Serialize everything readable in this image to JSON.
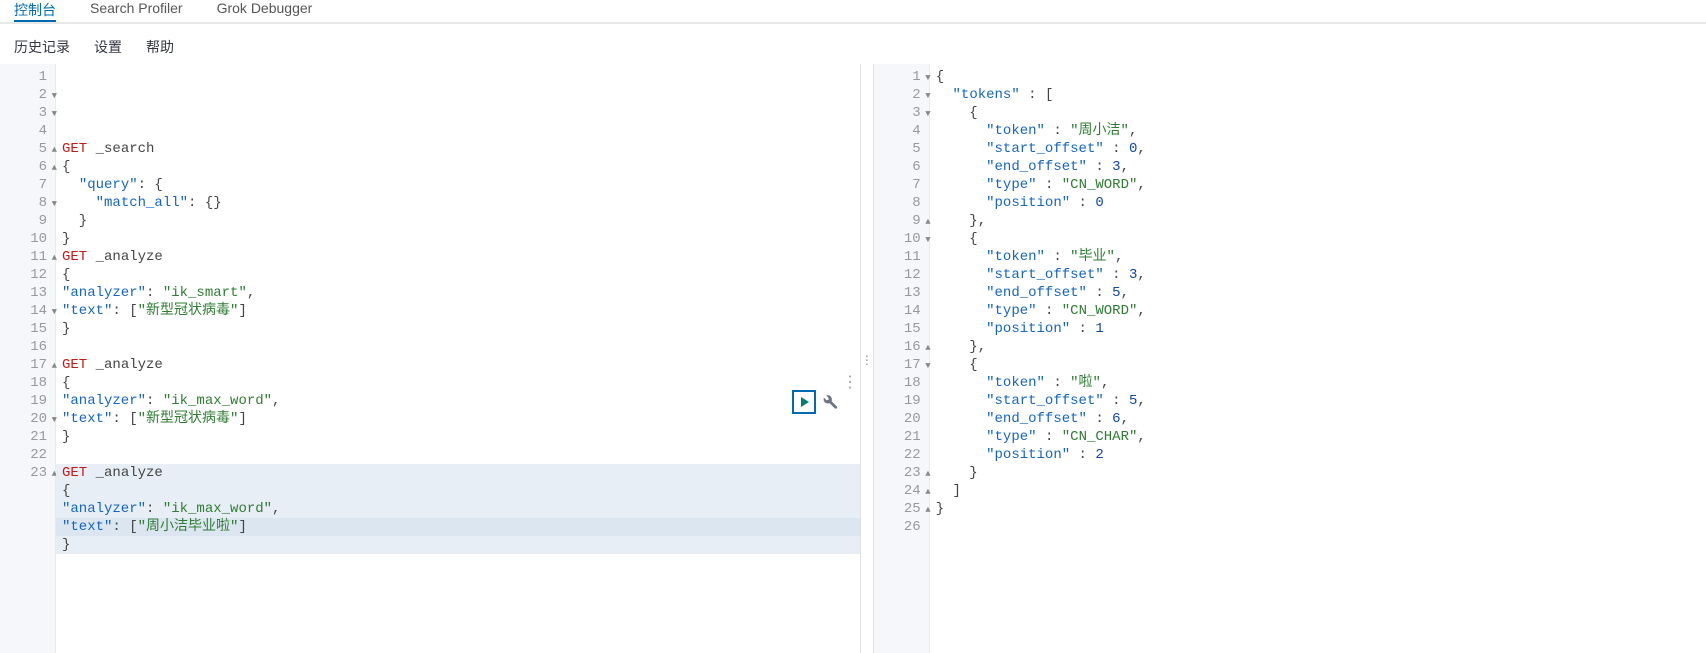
{
  "top_tabs": {
    "t1": "控制台",
    "t2": "Search Profiler",
    "t3": "Grok Debugger"
  },
  "submenu": {
    "history": "历史记录",
    "settings": "设置",
    "help": "帮助"
  },
  "editor": {
    "lines": [
      {
        "n": "1",
        "fold": "",
        "cls": "",
        "tokens": [
          [
            "method",
            "GET"
          ],
          [
            "punct",
            " "
          ],
          [
            "punct",
            "_search"
          ]
        ]
      },
      {
        "n": "2",
        "fold": "▼",
        "cls": "",
        "tokens": [
          [
            "punct",
            "{"
          ]
        ]
      },
      {
        "n": "3",
        "fold": "▼",
        "cls": "",
        "tokens": [
          [
            "punct",
            "  "
          ],
          [
            "key",
            "\"query\""
          ],
          [
            "punct",
            ": {"
          ]
        ]
      },
      {
        "n": "4",
        "fold": "",
        "cls": "",
        "tokens": [
          [
            "punct",
            "    "
          ],
          [
            "key",
            "\"match_all\""
          ],
          [
            "punct",
            ": {}"
          ]
        ]
      },
      {
        "n": "5",
        "fold": "▲",
        "cls": "",
        "tokens": [
          [
            "punct",
            "  }"
          ]
        ]
      },
      {
        "n": "6",
        "fold": "▲",
        "cls": "",
        "tokens": [
          [
            "punct",
            "}"
          ]
        ]
      },
      {
        "n": "7",
        "fold": "",
        "cls": "",
        "tokens": [
          [
            "method",
            "GET"
          ],
          [
            "punct",
            " "
          ],
          [
            "punct",
            "_analyze"
          ]
        ]
      },
      {
        "n": "8",
        "fold": "▼",
        "cls": "",
        "tokens": [
          [
            "punct",
            "{"
          ]
        ]
      },
      {
        "n": "9",
        "fold": "",
        "cls": "",
        "tokens": [
          [
            "key",
            "\"analyzer\""
          ],
          [
            "punct",
            ": "
          ],
          [
            "str",
            "\"ik_smart\""
          ],
          [
            "punct",
            ","
          ]
        ]
      },
      {
        "n": "10",
        "fold": "",
        "cls": "",
        "tokens": [
          [
            "key",
            "\"text\""
          ],
          [
            "punct",
            ": ["
          ],
          [
            "str",
            "\"新型冠状病毒\""
          ],
          [
            "punct",
            "]"
          ]
        ]
      },
      {
        "n": "11",
        "fold": "▲",
        "cls": "",
        "tokens": [
          [
            "punct",
            "}"
          ]
        ]
      },
      {
        "n": "12",
        "fold": "",
        "cls": "",
        "tokens": []
      },
      {
        "n": "13",
        "fold": "",
        "cls": "",
        "tokens": [
          [
            "method",
            "GET"
          ],
          [
            "punct",
            " "
          ],
          [
            "punct",
            "_analyze"
          ]
        ]
      },
      {
        "n": "14",
        "fold": "▼",
        "cls": "",
        "tokens": [
          [
            "punct",
            "{"
          ]
        ]
      },
      {
        "n": "15",
        "fold": "",
        "cls": "",
        "tokens": [
          [
            "key",
            "\"analyzer\""
          ],
          [
            "punct",
            ": "
          ],
          [
            "str",
            "\"ik_max_word\""
          ],
          [
            "punct",
            ","
          ]
        ]
      },
      {
        "n": "16",
        "fold": "",
        "cls": "",
        "tokens": [
          [
            "key",
            "\"text\""
          ],
          [
            "punct",
            ": ["
          ],
          [
            "str",
            "\"新型冠状病毒\""
          ],
          [
            "punct",
            "]"
          ]
        ]
      },
      {
        "n": "17",
        "fold": "▲",
        "cls": "",
        "tokens": [
          [
            "punct",
            "}"
          ]
        ]
      },
      {
        "n": "18",
        "fold": "",
        "cls": "",
        "tokens": []
      },
      {
        "n": "19",
        "fold": "",
        "cls": "hl-light",
        "tokens": [
          [
            "method",
            "GET"
          ],
          [
            "punct",
            " "
          ],
          [
            "punct",
            "_analyze"
          ]
        ]
      },
      {
        "n": "20",
        "fold": "▼",
        "cls": "hl-light",
        "tokens": [
          [
            "punct",
            "{"
          ]
        ]
      },
      {
        "n": "21",
        "fold": "",
        "cls": "hl-light",
        "tokens": [
          [
            "key",
            "\"analyzer\""
          ],
          [
            "punct",
            ": "
          ],
          [
            "str",
            "\"ik_max_word\""
          ],
          [
            "punct",
            ","
          ]
        ]
      },
      {
        "n": "22",
        "fold": "",
        "cls": "hl",
        "tokens": [
          [
            "key",
            "\"text\""
          ],
          [
            "punct",
            ": ["
          ],
          [
            "str",
            "\"周小洁毕业啦\""
          ],
          [
            "punct",
            "]"
          ]
        ]
      },
      {
        "n": "23",
        "fold": "▲",
        "cls": "hl-light",
        "tokens": [
          [
            "punct",
            "}"
          ]
        ]
      }
    ]
  },
  "output": {
    "lines": [
      {
        "n": "1",
        "fold": "▼",
        "tokens": [
          [
            "punct",
            "{"
          ]
        ]
      },
      {
        "n": "2",
        "fold": "▼",
        "tokens": [
          [
            "punct",
            "  "
          ],
          [
            "key",
            "\"tokens\""
          ],
          [
            "punct",
            " : ["
          ]
        ]
      },
      {
        "n": "3",
        "fold": "▼",
        "tokens": [
          [
            "punct",
            "    {"
          ]
        ]
      },
      {
        "n": "4",
        "fold": "",
        "tokens": [
          [
            "punct",
            "      "
          ],
          [
            "key",
            "\"token\""
          ],
          [
            "punct",
            " : "
          ],
          [
            "str",
            "\"周小洁\""
          ],
          [
            "punct",
            ","
          ]
        ]
      },
      {
        "n": "5",
        "fold": "",
        "tokens": [
          [
            "punct",
            "      "
          ],
          [
            "key",
            "\"start_offset\""
          ],
          [
            "punct",
            " : "
          ],
          [
            "num",
            "0"
          ],
          [
            "punct",
            ","
          ]
        ]
      },
      {
        "n": "6",
        "fold": "",
        "tokens": [
          [
            "punct",
            "      "
          ],
          [
            "key",
            "\"end_offset\""
          ],
          [
            "punct",
            " : "
          ],
          [
            "num",
            "3"
          ],
          [
            "punct",
            ","
          ]
        ]
      },
      {
        "n": "7",
        "fold": "",
        "tokens": [
          [
            "punct",
            "      "
          ],
          [
            "key",
            "\"type\""
          ],
          [
            "punct",
            " : "
          ],
          [
            "str",
            "\"CN_WORD\""
          ],
          [
            "punct",
            ","
          ]
        ]
      },
      {
        "n": "8",
        "fold": "",
        "tokens": [
          [
            "punct",
            "      "
          ],
          [
            "key",
            "\"position\""
          ],
          [
            "punct",
            " : "
          ],
          [
            "num",
            "0"
          ]
        ]
      },
      {
        "n": "9",
        "fold": "▲",
        "tokens": [
          [
            "punct",
            "    },"
          ]
        ]
      },
      {
        "n": "10",
        "fold": "▼",
        "tokens": [
          [
            "punct",
            "    {"
          ]
        ]
      },
      {
        "n": "11",
        "fold": "",
        "tokens": [
          [
            "punct",
            "      "
          ],
          [
            "key",
            "\"token\""
          ],
          [
            "punct",
            " : "
          ],
          [
            "str",
            "\"毕业\""
          ],
          [
            "punct",
            ","
          ]
        ]
      },
      {
        "n": "12",
        "fold": "",
        "tokens": [
          [
            "punct",
            "      "
          ],
          [
            "key",
            "\"start_offset\""
          ],
          [
            "punct",
            " : "
          ],
          [
            "num",
            "3"
          ],
          [
            "punct",
            ","
          ]
        ]
      },
      {
        "n": "13",
        "fold": "",
        "tokens": [
          [
            "punct",
            "      "
          ],
          [
            "key",
            "\"end_offset\""
          ],
          [
            "punct",
            " : "
          ],
          [
            "num",
            "5"
          ],
          [
            "punct",
            ","
          ]
        ]
      },
      {
        "n": "14",
        "fold": "",
        "tokens": [
          [
            "punct",
            "      "
          ],
          [
            "key",
            "\"type\""
          ],
          [
            "punct",
            " : "
          ],
          [
            "str",
            "\"CN_WORD\""
          ],
          [
            "punct",
            ","
          ]
        ]
      },
      {
        "n": "15",
        "fold": "",
        "tokens": [
          [
            "punct",
            "      "
          ],
          [
            "key",
            "\"position\""
          ],
          [
            "punct",
            " : "
          ],
          [
            "num",
            "1"
          ]
        ]
      },
      {
        "n": "16",
        "fold": "▲",
        "tokens": [
          [
            "punct",
            "    },"
          ]
        ]
      },
      {
        "n": "17",
        "fold": "▼",
        "tokens": [
          [
            "punct",
            "    {"
          ]
        ]
      },
      {
        "n": "18",
        "fold": "",
        "tokens": [
          [
            "punct",
            "      "
          ],
          [
            "key",
            "\"token\""
          ],
          [
            "punct",
            " : "
          ],
          [
            "str",
            "\"啦\""
          ],
          [
            "punct",
            ","
          ]
        ]
      },
      {
        "n": "19",
        "fold": "",
        "tokens": [
          [
            "punct",
            "      "
          ],
          [
            "key",
            "\"start_offset\""
          ],
          [
            "punct",
            " : "
          ],
          [
            "num",
            "5"
          ],
          [
            "punct",
            ","
          ]
        ]
      },
      {
        "n": "20",
        "fold": "",
        "tokens": [
          [
            "punct",
            "      "
          ],
          [
            "key",
            "\"end_offset\""
          ],
          [
            "punct",
            " : "
          ],
          [
            "num",
            "6"
          ],
          [
            "punct",
            ","
          ]
        ]
      },
      {
        "n": "21",
        "fold": "",
        "tokens": [
          [
            "punct",
            "      "
          ],
          [
            "key",
            "\"type\""
          ],
          [
            "punct",
            " : "
          ],
          [
            "str",
            "\"CN_CHAR\""
          ],
          [
            "punct",
            ","
          ]
        ]
      },
      {
        "n": "22",
        "fold": "",
        "tokens": [
          [
            "punct",
            "      "
          ],
          [
            "key",
            "\"position\""
          ],
          [
            "punct",
            " : "
          ],
          [
            "num",
            "2"
          ]
        ]
      },
      {
        "n": "23",
        "fold": "▲",
        "tokens": [
          [
            "punct",
            "    }"
          ]
        ]
      },
      {
        "n": "24",
        "fold": "▲",
        "tokens": [
          [
            "punct",
            "  ]"
          ]
        ]
      },
      {
        "n": "25",
        "fold": "▲",
        "tokens": [
          [
            "punct",
            "}"
          ]
        ]
      },
      {
        "n": "26",
        "fold": "",
        "tokens": []
      }
    ]
  }
}
